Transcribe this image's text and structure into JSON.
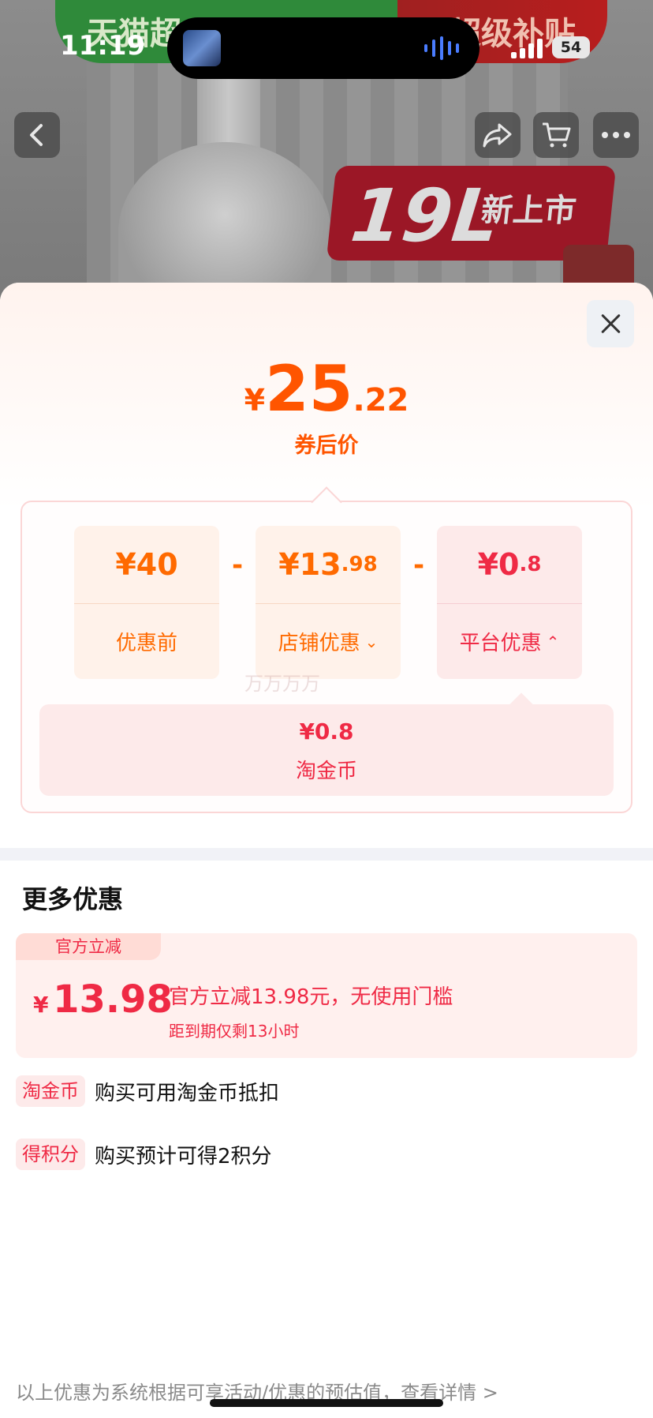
{
  "status_bar": {
    "time": "11:19",
    "battery": "54"
  },
  "background_page": {
    "banner_left": "天猫超",
    "banner_right": "超级补贴",
    "promo_big": "19L",
    "promo_small": "新上市"
  },
  "sheet": {
    "final_price": {
      "currency": "¥",
      "integer": "25",
      "decimal": ".22",
      "label": "券后价"
    },
    "breakdown": {
      "cards": [
        {
          "value_main": "¥40",
          "value_small": "",
          "label": "优惠前",
          "chevron": ""
        },
        {
          "value_main": "¥13",
          "value_small": ".98",
          "label": "店铺优惠",
          "chevron": "⌄"
        },
        {
          "value_main": "¥0",
          "value_small": ".8",
          "label": "平台优惠",
          "chevron": "⌃"
        }
      ],
      "operator": "-",
      "sub_item": {
        "value": "¥0.8",
        "label": "淘金币"
      },
      "watermark": "万万万万"
    },
    "more_offers": {
      "title": "更多优惠",
      "coupon": {
        "tag": "官方立减",
        "currency": "¥",
        "amount": "13.98",
        "description": "官方立减13.98元，无使用门槛",
        "expiry": "距到期仅剩13小时"
      },
      "benefits": [
        {
          "tag": "淘金币",
          "text": "购买可用淘金币抵扣"
        },
        {
          "tag": "得积分",
          "text": "购买预计可得2积分"
        }
      ]
    },
    "footer_note": "以上优惠为系统根据可享活动/优惠的预估值，查看详情 >"
  },
  "colors": {
    "price_orange": "#ff5500",
    "discount_red": "#ef2a45"
  }
}
